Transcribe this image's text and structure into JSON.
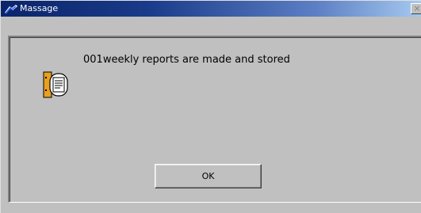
{
  "window": {
    "title": "Massage",
    "close_glyph": "×",
    "title_icon": "app-icon"
  },
  "dialog": {
    "message": "001weekly reports are made and stored",
    "message_icon": "report-document-icon",
    "ok_label": "OK"
  },
  "colors": {
    "titlebar_start": "#0a246a",
    "titlebar_end": "#a6caf0",
    "face": "#c0c0c0"
  }
}
